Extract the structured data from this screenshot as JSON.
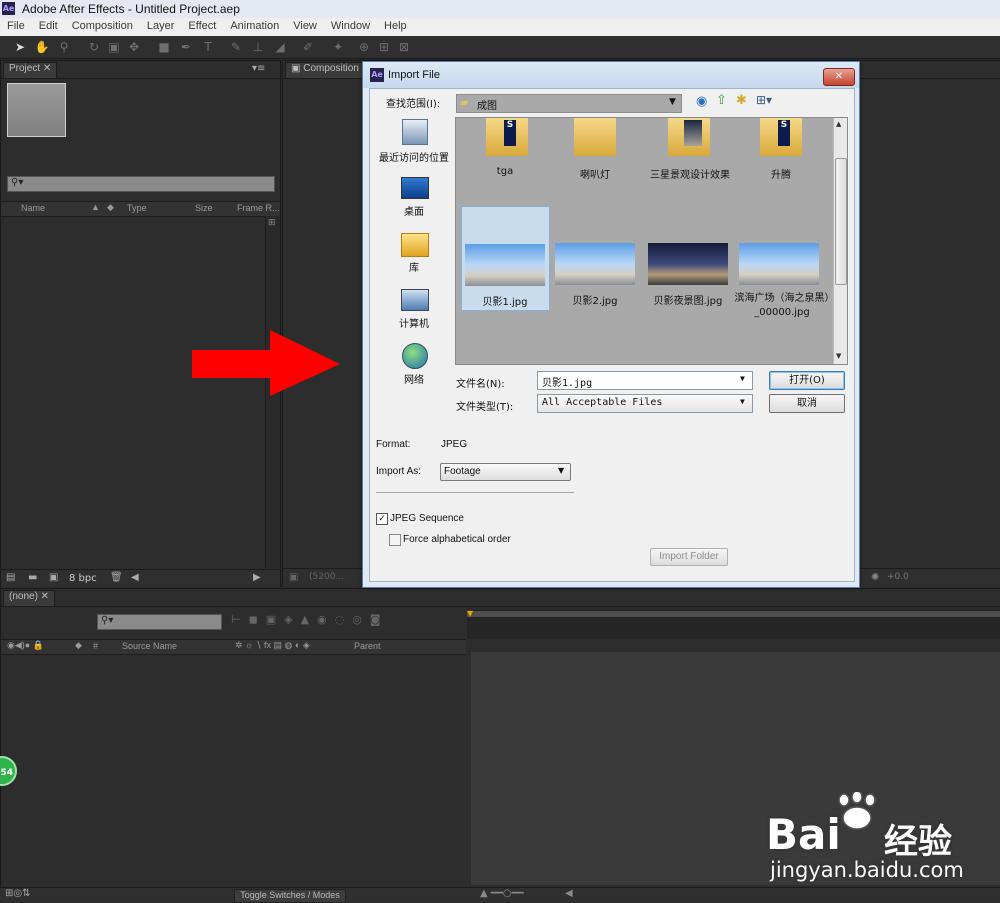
{
  "window": {
    "app_icon": "Ae",
    "title": "Adobe After Effects - Untitled Project.aep"
  },
  "menu": [
    "File",
    "Edit",
    "Composition",
    "Layer",
    "Effect",
    "Animation",
    "View",
    "Window",
    "Help"
  ],
  "project_panel": {
    "tab": "Project",
    "columns": {
      "name": "Name",
      "type": "Type",
      "size": "Size",
      "frame_rate": "Frame R..."
    },
    "bpc": "8 bpc"
  },
  "composition_panel": {
    "tab": "Composition",
    "zoom": "(5200...",
    "exposure": "+0.0"
  },
  "timeline_panel": {
    "tab": "(none)",
    "columns": {
      "source_name": "Source Name",
      "hash": "#",
      "parent": "Parent"
    },
    "toggle_label": "Toggle Switches / Modes",
    "badge": "54"
  },
  "dialog": {
    "title_icon": "Ae",
    "title": "Import File",
    "look_in_label": "查找范围(I):",
    "look_in_value": "成图",
    "places": [
      {
        "label": "最近访问的位置",
        "icon": "recent-places-icon"
      },
      {
        "label": "桌面",
        "icon": "desktop-icon"
      },
      {
        "label": "库",
        "icon": "libraries-icon"
      },
      {
        "label": "计算机",
        "icon": "computer-icon"
      },
      {
        "label": "网络",
        "icon": "network-icon"
      }
    ],
    "folders": [
      "tga",
      "喇叭灯",
      "三星景观设计效果",
      "升腾"
    ],
    "files": [
      "贝影1.jpg",
      "贝影2.jpg",
      "贝影夜景图.jpg",
      "滨海广场（海之泉黑）_00000.jpg"
    ],
    "file_name_label": "文件名(N):",
    "file_name_value": "贝影1.jpg",
    "file_type_label": "文件类型(T):",
    "file_type_value": "All Acceptable Files",
    "open_button": "打开(O)",
    "cancel_button": "取消",
    "format_label": "Format:",
    "format_value": "JPEG",
    "import_as_label": "Import As:",
    "import_as_value": "Footage",
    "jpeg_sequence_label": "JPEG Sequence",
    "jpeg_sequence_checked": true,
    "force_alpha_label": "Force alphabetical order",
    "force_alpha_checked": false,
    "import_folder_button": "Import Folder"
  },
  "watermark": {
    "brand": "Bai",
    "brand2": "经验",
    "url": "jingyan.baidu.com"
  },
  "colors": {
    "arrow": "#ff0000",
    "selection": "#cce4f7",
    "dialog_frame": "#dfe8f3"
  }
}
